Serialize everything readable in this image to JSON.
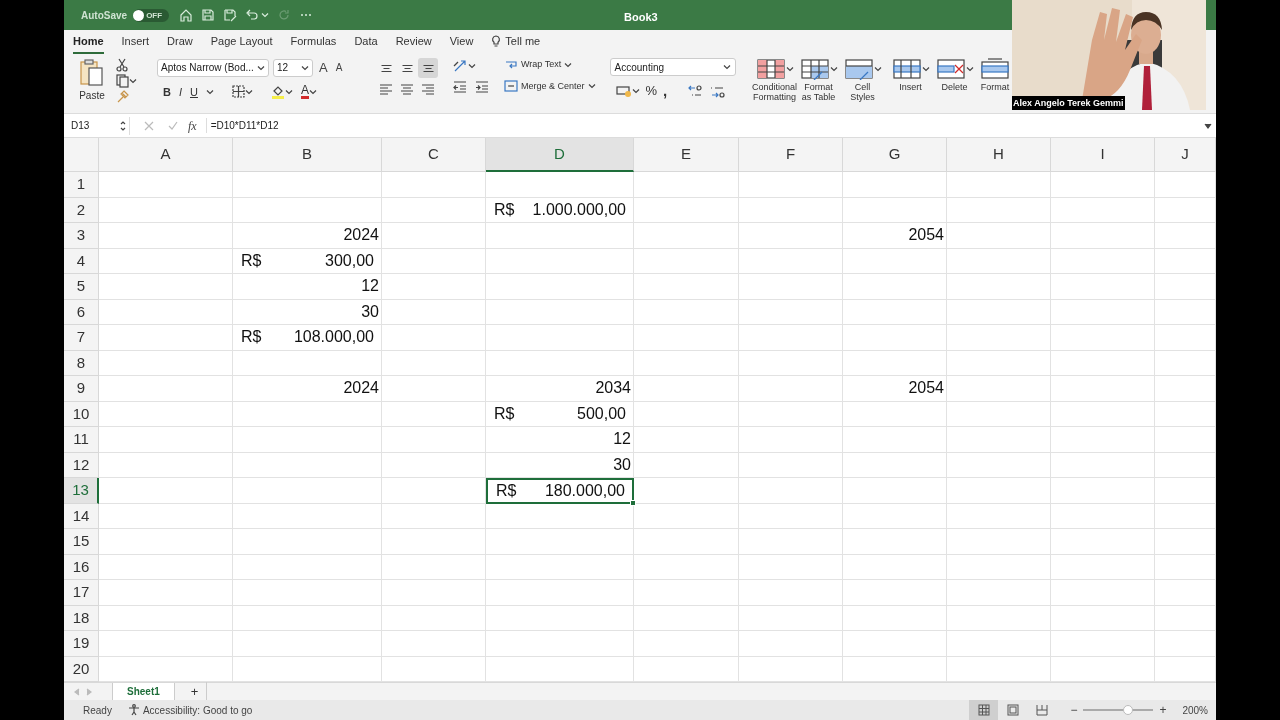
{
  "title_bar": {
    "autosave_label": "AutoSave",
    "autosave": {
      "on": false,
      "label": "OFF"
    },
    "document_title": "Book3"
  },
  "ribbon_tabs": [
    {
      "label": "Home",
      "selected": true,
      "kind": "tab"
    },
    {
      "label": "Insert",
      "selected": false,
      "kind": "tab"
    },
    {
      "label": "Draw",
      "selected": false,
      "kind": "tab"
    },
    {
      "label": "Page Layout",
      "selected": false,
      "kind": "tab"
    },
    {
      "label": "Formulas",
      "selected": false,
      "kind": "tab"
    },
    {
      "label": "Data",
      "selected": false,
      "kind": "tab"
    },
    {
      "label": "Review",
      "selected": false,
      "kind": "tab"
    },
    {
      "label": "View",
      "selected": false,
      "kind": "tab"
    },
    {
      "label": "Tell me",
      "selected": false,
      "kind": "search"
    }
  ],
  "ribbon": {
    "paste": "Paste",
    "font_name": "Aptos Narrow (Bod...",
    "font_size": "12",
    "font_size_buttons": [
      "A",
      "A"
    ],
    "style_buttons": [
      "B",
      "I",
      "U"
    ],
    "font_color": "A",
    "vertical_alignment": [
      {
        "selected": false
      },
      {
        "selected": false
      },
      {
        "selected": true
      }
    ],
    "wrap_text": "Wrap Text",
    "merge_center": "Merge & Center",
    "number_format": "Accounting",
    "percent": "%",
    "comma": ",",
    "style_commands": [
      {
        "label": "Conditional Formatting",
        "kind": "conditional"
      },
      {
        "label": "Format as Table",
        "kind": "table"
      },
      {
        "label": "Cell Styles",
        "kind": "styles"
      }
    ],
    "cell_commands": [
      {
        "label": "Insert",
        "kind": "insert"
      },
      {
        "label": "Delete",
        "kind": "delete"
      },
      {
        "label": "Format",
        "kind": "format"
      }
    ]
  },
  "formula_bar": {
    "name_box": "D13",
    "fx": "fx",
    "formula": "=D10*D11*D12"
  },
  "webcam": {
    "kind": "picture",
    "caption": "Alex Angelo Terek Gemmi"
  },
  "columns": [
    {
      "label": "A",
      "selected": false
    },
    {
      "label": "B",
      "selected": false
    },
    {
      "label": "C",
      "selected": false
    },
    {
      "label": "D",
      "selected": true
    },
    {
      "label": "E",
      "selected": false
    },
    {
      "label": "F",
      "selected": false
    },
    {
      "label": "G",
      "selected": false
    },
    {
      "label": "H",
      "selected": false
    },
    {
      "label": "I",
      "selected": false
    },
    {
      "label": "J",
      "selected": false
    }
  ],
  "rows": [
    {
      "label": "1",
      "selected": false,
      "cells": [
        {
          "kind": "empty",
          "selected": false
        },
        {
          "kind": "empty",
          "selected": false
        },
        {
          "kind": "empty",
          "selected": false
        },
        {
          "kind": "empty",
          "selected": false
        },
        {
          "kind": "empty",
          "selected": false
        },
        {
          "kind": "empty",
          "selected": false
        },
        {
          "kind": "empty",
          "selected": false
        },
        {
          "kind": "empty",
          "selected": false
        },
        {
          "kind": "empty",
          "selected": false
        },
        {
          "kind": "empty",
          "selected": false
        }
      ]
    },
    {
      "label": "2",
      "selected": false,
      "cells": [
        {
          "kind": "empty",
          "selected": false
        },
        {
          "kind": "empty",
          "selected": false
        },
        {
          "kind": "empty",
          "selected": false
        },
        {
          "kind": "accounting",
          "currency": "R$",
          "amount": "1.000.000,00",
          "selected": false
        },
        {
          "kind": "empty",
          "selected": false
        },
        {
          "kind": "empty",
          "selected": false
        },
        {
          "kind": "empty",
          "selected": false
        },
        {
          "kind": "empty",
          "selected": false
        },
        {
          "kind": "empty",
          "selected": false
        },
        {
          "kind": "empty",
          "selected": false
        }
      ]
    },
    {
      "label": "3",
      "selected": false,
      "cells": [
        {
          "kind": "empty",
          "selected": false
        },
        {
          "kind": "number",
          "amount": "2024",
          "selected": false
        },
        {
          "kind": "empty",
          "selected": false
        },
        {
          "kind": "empty",
          "selected": false
        },
        {
          "kind": "empty",
          "selected": false
        },
        {
          "kind": "empty",
          "selected": false
        },
        {
          "kind": "number",
          "amount": "2054",
          "selected": false
        },
        {
          "kind": "empty",
          "selected": false
        },
        {
          "kind": "empty",
          "selected": false
        },
        {
          "kind": "empty",
          "selected": false
        }
      ]
    },
    {
      "label": "4",
      "selected": false,
      "cells": [
        {
          "kind": "empty",
          "selected": false
        },
        {
          "kind": "accounting",
          "currency": "R$",
          "amount": "300,00",
          "selected": false
        },
        {
          "kind": "empty",
          "selected": false
        },
        {
          "kind": "empty",
          "selected": false
        },
        {
          "kind": "empty",
          "selected": false
        },
        {
          "kind": "empty",
          "selected": false
        },
        {
          "kind": "empty",
          "selected": false
        },
        {
          "kind": "empty",
          "selected": false
        },
        {
          "kind": "empty",
          "selected": false
        },
        {
          "kind": "empty",
          "selected": false
        }
      ]
    },
    {
      "label": "5",
      "selected": false,
      "cells": [
        {
          "kind": "empty",
          "selected": false
        },
        {
          "kind": "number",
          "amount": "12",
          "selected": false
        },
        {
          "kind": "empty",
          "selected": false
        },
        {
          "kind": "empty",
          "selected": false
        },
        {
          "kind": "empty",
          "selected": false
        },
        {
          "kind": "empty",
          "selected": false
        },
        {
          "kind": "empty",
          "selected": false
        },
        {
          "kind": "empty",
          "selected": false
        },
        {
          "kind": "empty",
          "selected": false
        },
        {
          "kind": "empty",
          "selected": false
        }
      ]
    },
    {
      "label": "6",
      "selected": false,
      "cells": [
        {
          "kind": "empty",
          "selected": false
        },
        {
          "kind": "number",
          "amount": "30",
          "selected": false
        },
        {
          "kind": "empty",
          "selected": false
        },
        {
          "kind": "empty",
          "selected": false
        },
        {
          "kind": "empty",
          "selected": false
        },
        {
          "kind": "empty",
          "selected": false
        },
        {
          "kind": "empty",
          "selected": false
        },
        {
          "kind": "empty",
          "selected": false
        },
        {
          "kind": "empty",
          "selected": false
        },
        {
          "kind": "empty",
          "selected": false
        }
      ]
    },
    {
      "label": "7",
      "selected": false,
      "cells": [
        {
          "kind": "empty",
          "selected": false
        },
        {
          "kind": "accounting",
          "currency": "R$",
          "amount": "108.000,00",
          "selected": false
        },
        {
          "kind": "empty",
          "selected": false
        },
        {
          "kind": "empty",
          "selected": false
        },
        {
          "kind": "empty",
          "selected": false
        },
        {
          "kind": "empty",
          "selected": false
        },
        {
          "kind": "empty",
          "selected": false
        },
        {
          "kind": "empty",
          "selected": false
        },
        {
          "kind": "empty",
          "selected": false
        },
        {
          "kind": "empty",
          "selected": false
        }
      ]
    },
    {
      "label": "8",
      "selected": false,
      "cells": [
        {
          "kind": "empty",
          "selected": false
        },
        {
          "kind": "empty",
          "selected": false
        },
        {
          "kind": "empty",
          "selected": false
        },
        {
          "kind": "empty",
          "selected": false
        },
        {
          "kind": "empty",
          "selected": false
        },
        {
          "kind": "empty",
          "selected": false
        },
        {
          "kind": "empty",
          "selected": false
        },
        {
          "kind": "empty",
          "selected": false
        },
        {
          "kind": "empty",
          "selected": false
        },
        {
          "kind": "empty",
          "selected": false
        }
      ]
    },
    {
      "label": "9",
      "selected": false,
      "cells": [
        {
          "kind": "empty",
          "selected": false
        },
        {
          "kind": "number",
          "amount": "2024",
          "selected": false
        },
        {
          "kind": "empty",
          "selected": false
        },
        {
          "kind": "number",
          "amount": "2034",
          "selected": false
        },
        {
          "kind": "empty",
          "selected": false
        },
        {
          "kind": "empty",
          "selected": false
        },
        {
          "kind": "number",
          "amount": "2054",
          "selected": false
        },
        {
          "kind": "empty",
          "selected": false
        },
        {
          "kind": "empty",
          "selected": false
        },
        {
          "kind": "empty",
          "selected": false
        }
      ]
    },
    {
      "label": "10",
      "selected": false,
      "cells": [
        {
          "kind": "empty",
          "selected": false
        },
        {
          "kind": "empty",
          "selected": false
        },
        {
          "kind": "empty",
          "selected": false
        },
        {
          "kind": "accounting",
          "currency": "R$",
          "amount": "500,00",
          "selected": false
        },
        {
          "kind": "empty",
          "selected": false
        },
        {
          "kind": "empty",
          "selected": false
        },
        {
          "kind": "empty",
          "selected": false
        },
        {
          "kind": "empty",
          "selected": false
        },
        {
          "kind": "empty",
          "selected": false
        },
        {
          "kind": "empty",
          "selected": false
        }
      ]
    },
    {
      "label": "11",
      "selected": false,
      "cells": [
        {
          "kind": "empty",
          "selected": false
        },
        {
          "kind": "empty",
          "selected": false
        },
        {
          "kind": "empty",
          "selected": false
        },
        {
          "kind": "number",
          "amount": "12",
          "selected": false
        },
        {
          "kind": "empty",
          "selected": false
        },
        {
          "kind": "empty",
          "selected": false
        },
        {
          "kind": "empty",
          "selected": false
        },
        {
          "kind": "empty",
          "selected": false
        },
        {
          "kind": "empty",
          "selected": false
        },
        {
          "kind": "empty",
          "selected": false
        }
      ]
    },
    {
      "label": "12",
      "selected": false,
      "cells": [
        {
          "kind": "empty",
          "selected": false
        },
        {
          "kind": "empty",
          "selected": false
        },
        {
          "kind": "empty",
          "selected": false
        },
        {
          "kind": "number",
          "amount": "30",
          "selected": false
        },
        {
          "kind": "empty",
          "selected": false
        },
        {
          "kind": "empty",
          "selected": false
        },
        {
          "kind": "empty",
          "selected": false
        },
        {
          "kind": "empty",
          "selected": false
        },
        {
          "kind": "empty",
          "selected": false
        },
        {
          "kind": "empty",
          "selected": false
        }
      ]
    },
    {
      "label": "13",
      "selected": true,
      "cells": [
        {
          "kind": "empty",
          "selected": false
        },
        {
          "kind": "empty",
          "selected": false
        },
        {
          "kind": "empty",
          "selected": false
        },
        {
          "kind": "accounting",
          "currency": "R$",
          "amount": "180.000,00",
          "selected": true
        },
        {
          "kind": "empty",
          "selected": false
        },
        {
          "kind": "empty",
          "selected": false
        },
        {
          "kind": "empty",
          "selected": false
        },
        {
          "kind": "empty",
          "selected": false
        },
        {
          "kind": "empty",
          "selected": false
        },
        {
          "kind": "empty",
          "selected": false
        }
      ]
    },
    {
      "label": "14",
      "selected": false,
      "cells": [
        {
          "kind": "empty",
          "selected": false
        },
        {
          "kind": "empty",
          "selected": false
        },
        {
          "kind": "empty",
          "selected": false
        },
        {
          "kind": "empty",
          "selected": false
        },
        {
          "kind": "empty",
          "selected": false
        },
        {
          "kind": "empty",
          "selected": false
        },
        {
          "kind": "empty",
          "selected": false
        },
        {
          "kind": "empty",
          "selected": false
        },
        {
          "kind": "empty",
          "selected": false
        },
        {
          "kind": "empty",
          "selected": false
        }
      ]
    },
    {
      "label": "15",
      "selected": false,
      "cells": [
        {
          "kind": "empty",
          "selected": false
        },
        {
          "kind": "empty",
          "selected": false
        },
        {
          "kind": "empty",
          "selected": false
        },
        {
          "kind": "empty",
          "selected": false
        },
        {
          "kind": "empty",
          "selected": false
        },
        {
          "kind": "empty",
          "selected": false
        },
        {
          "kind": "empty",
          "selected": false
        },
        {
          "kind": "empty",
          "selected": false
        },
        {
          "kind": "empty",
          "selected": false
        },
        {
          "kind": "empty",
          "selected": false
        }
      ]
    },
    {
      "label": "16",
      "selected": false,
      "cells": [
        {
          "kind": "empty",
          "selected": false
        },
        {
          "kind": "empty",
          "selected": false
        },
        {
          "kind": "empty",
          "selected": false
        },
        {
          "kind": "empty",
          "selected": false
        },
        {
          "kind": "empty",
          "selected": false
        },
        {
          "kind": "empty",
          "selected": false
        },
        {
          "kind": "empty",
          "selected": false
        },
        {
          "kind": "empty",
          "selected": false
        },
        {
          "kind": "empty",
          "selected": false
        },
        {
          "kind": "empty",
          "selected": false
        }
      ]
    },
    {
      "label": "17",
      "selected": false,
      "cells": [
        {
          "kind": "empty",
          "selected": false
        },
        {
          "kind": "empty",
          "selected": false
        },
        {
          "kind": "empty",
          "selected": false
        },
        {
          "kind": "empty",
          "selected": false
        },
        {
          "kind": "empty",
          "selected": false
        },
        {
          "kind": "empty",
          "selected": false
        },
        {
          "kind": "empty",
          "selected": false
        },
        {
          "kind": "empty",
          "selected": false
        },
        {
          "kind": "empty",
          "selected": false
        },
        {
          "kind": "empty",
          "selected": false
        }
      ]
    },
    {
      "label": "18",
      "selected": false,
      "cells": [
        {
          "kind": "empty",
          "selected": false
        },
        {
          "kind": "empty",
          "selected": false
        },
        {
          "kind": "empty",
          "selected": false
        },
        {
          "kind": "empty",
          "selected": false
        },
        {
          "kind": "empty",
          "selected": false
        },
        {
          "kind": "empty",
          "selected": false
        },
        {
          "kind": "empty",
          "selected": false
        },
        {
          "kind": "empty",
          "selected": false
        },
        {
          "kind": "empty",
          "selected": false
        },
        {
          "kind": "empty",
          "selected": false
        }
      ]
    },
    {
      "label": "19",
      "selected": false,
      "cells": [
        {
          "kind": "empty",
          "selected": false
        },
        {
          "kind": "empty",
          "selected": false
        },
        {
          "kind": "empty",
          "selected": false
        },
        {
          "kind": "empty",
          "selected": false
        },
        {
          "kind": "empty",
          "selected": false
        },
        {
          "kind": "empty",
          "selected": false
        },
        {
          "kind": "empty",
          "selected": false
        },
        {
          "kind": "empty",
          "selected": false
        },
        {
          "kind": "empty",
          "selected": false
        },
        {
          "kind": "empty",
          "selected": false
        }
      ]
    },
    {
      "label": "20",
      "selected": false,
      "cells": [
        {
          "kind": "empty",
          "selected": false
        },
        {
          "kind": "empty",
          "selected": false
        },
        {
          "kind": "empty",
          "selected": false
        },
        {
          "kind": "empty",
          "selected": false
        },
        {
          "kind": "empty",
          "selected": false
        },
        {
          "kind": "empty",
          "selected": false
        },
        {
          "kind": "empty",
          "selected": false
        },
        {
          "kind": "empty",
          "selected": false
        },
        {
          "kind": "empty",
          "selected": false
        },
        {
          "kind": "empty",
          "selected": false
        }
      ]
    }
  ],
  "sheet_tabs": [
    {
      "label": "Sheet1",
      "selected": true
    }
  ],
  "add_sheet": "+",
  "status_bar": {
    "status": "Ready",
    "accessibility": "Accessibility: Good to go",
    "views": [
      {
        "kind": "normal",
        "selected": true
      },
      {
        "kind": "page_layout",
        "selected": false
      },
      {
        "kind": "page_break",
        "selected": false
      }
    ],
    "zoom_out": "−",
    "zoom_in": "+",
    "zoom": {
      "level": 0.63
    },
    "zoom_reading": "200%"
  }
}
